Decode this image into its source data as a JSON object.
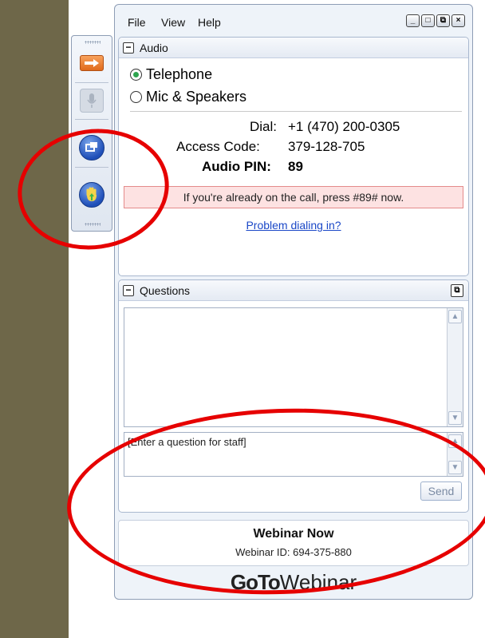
{
  "menu": [
    "File",
    "View",
    "Help"
  ],
  "window_buttons": [
    "_",
    "□",
    "⧉",
    "×"
  ],
  "audio": {
    "title": "Audio",
    "options": [
      "Telephone",
      "Mic & Speakers"
    ],
    "selected": "Telephone",
    "dial_label": "Dial:",
    "dial_value": "+1 (470) 200-0305",
    "access_label": "Access Code:",
    "access_value": "379-128-705",
    "pin_label": "Audio PIN:",
    "pin_value": "89",
    "alert": "If you're already on the call, press #89# now.",
    "problem_link": "Problem dialing in?"
  },
  "questions": {
    "title": "Questions",
    "input_value": "[Enter a question for staff]",
    "send_label": "Send"
  },
  "footer": {
    "title": "Webinar Now",
    "webinar_id": "Webinar ID: 694-375-880",
    "logo_bold": "GoTo",
    "logo_rest": "Webinar"
  },
  "colors": {
    "annotation": "#e60000",
    "alert_bg": "#fde2e2",
    "link": "#1a47c7"
  }
}
